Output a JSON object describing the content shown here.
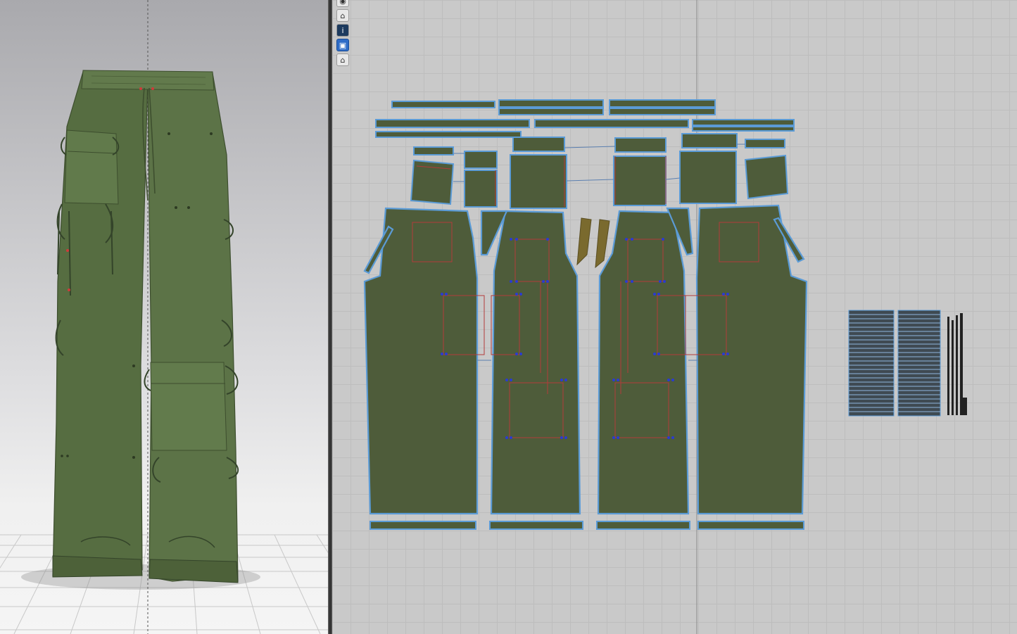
{
  "app": {
    "viewports": {
      "left": "3d-avatar-view",
      "right": "2d-pattern-view"
    },
    "colors": {
      "fabric": "#4e5c3a",
      "fabric_3d": "#5a6e45",
      "pattern_outline": "#5b9bd6",
      "internal_line": "#b23b3b",
      "pin_point": "#2a3bd1",
      "grid": "#bdbdbd",
      "background_2d": "#c9c9c9",
      "binding_fabric": "#7a6a2e"
    }
  },
  "toolbar2d": {
    "tools": [
      {
        "name": "show-hide-tool",
        "icon": "eye-icon",
        "glyph": "◉"
      },
      {
        "name": "avatar-view-tool",
        "icon": "shirt-icon",
        "glyph": "⌂"
      },
      {
        "name": "info-tool",
        "icon": "info-icon",
        "glyph": "i"
      },
      {
        "name": "texture-tool",
        "icon": "texture-icon",
        "glyph": "▣"
      },
      {
        "name": "lock-tool",
        "icon": "lock-icon",
        "glyph": "⌂"
      }
    ]
  }
}
